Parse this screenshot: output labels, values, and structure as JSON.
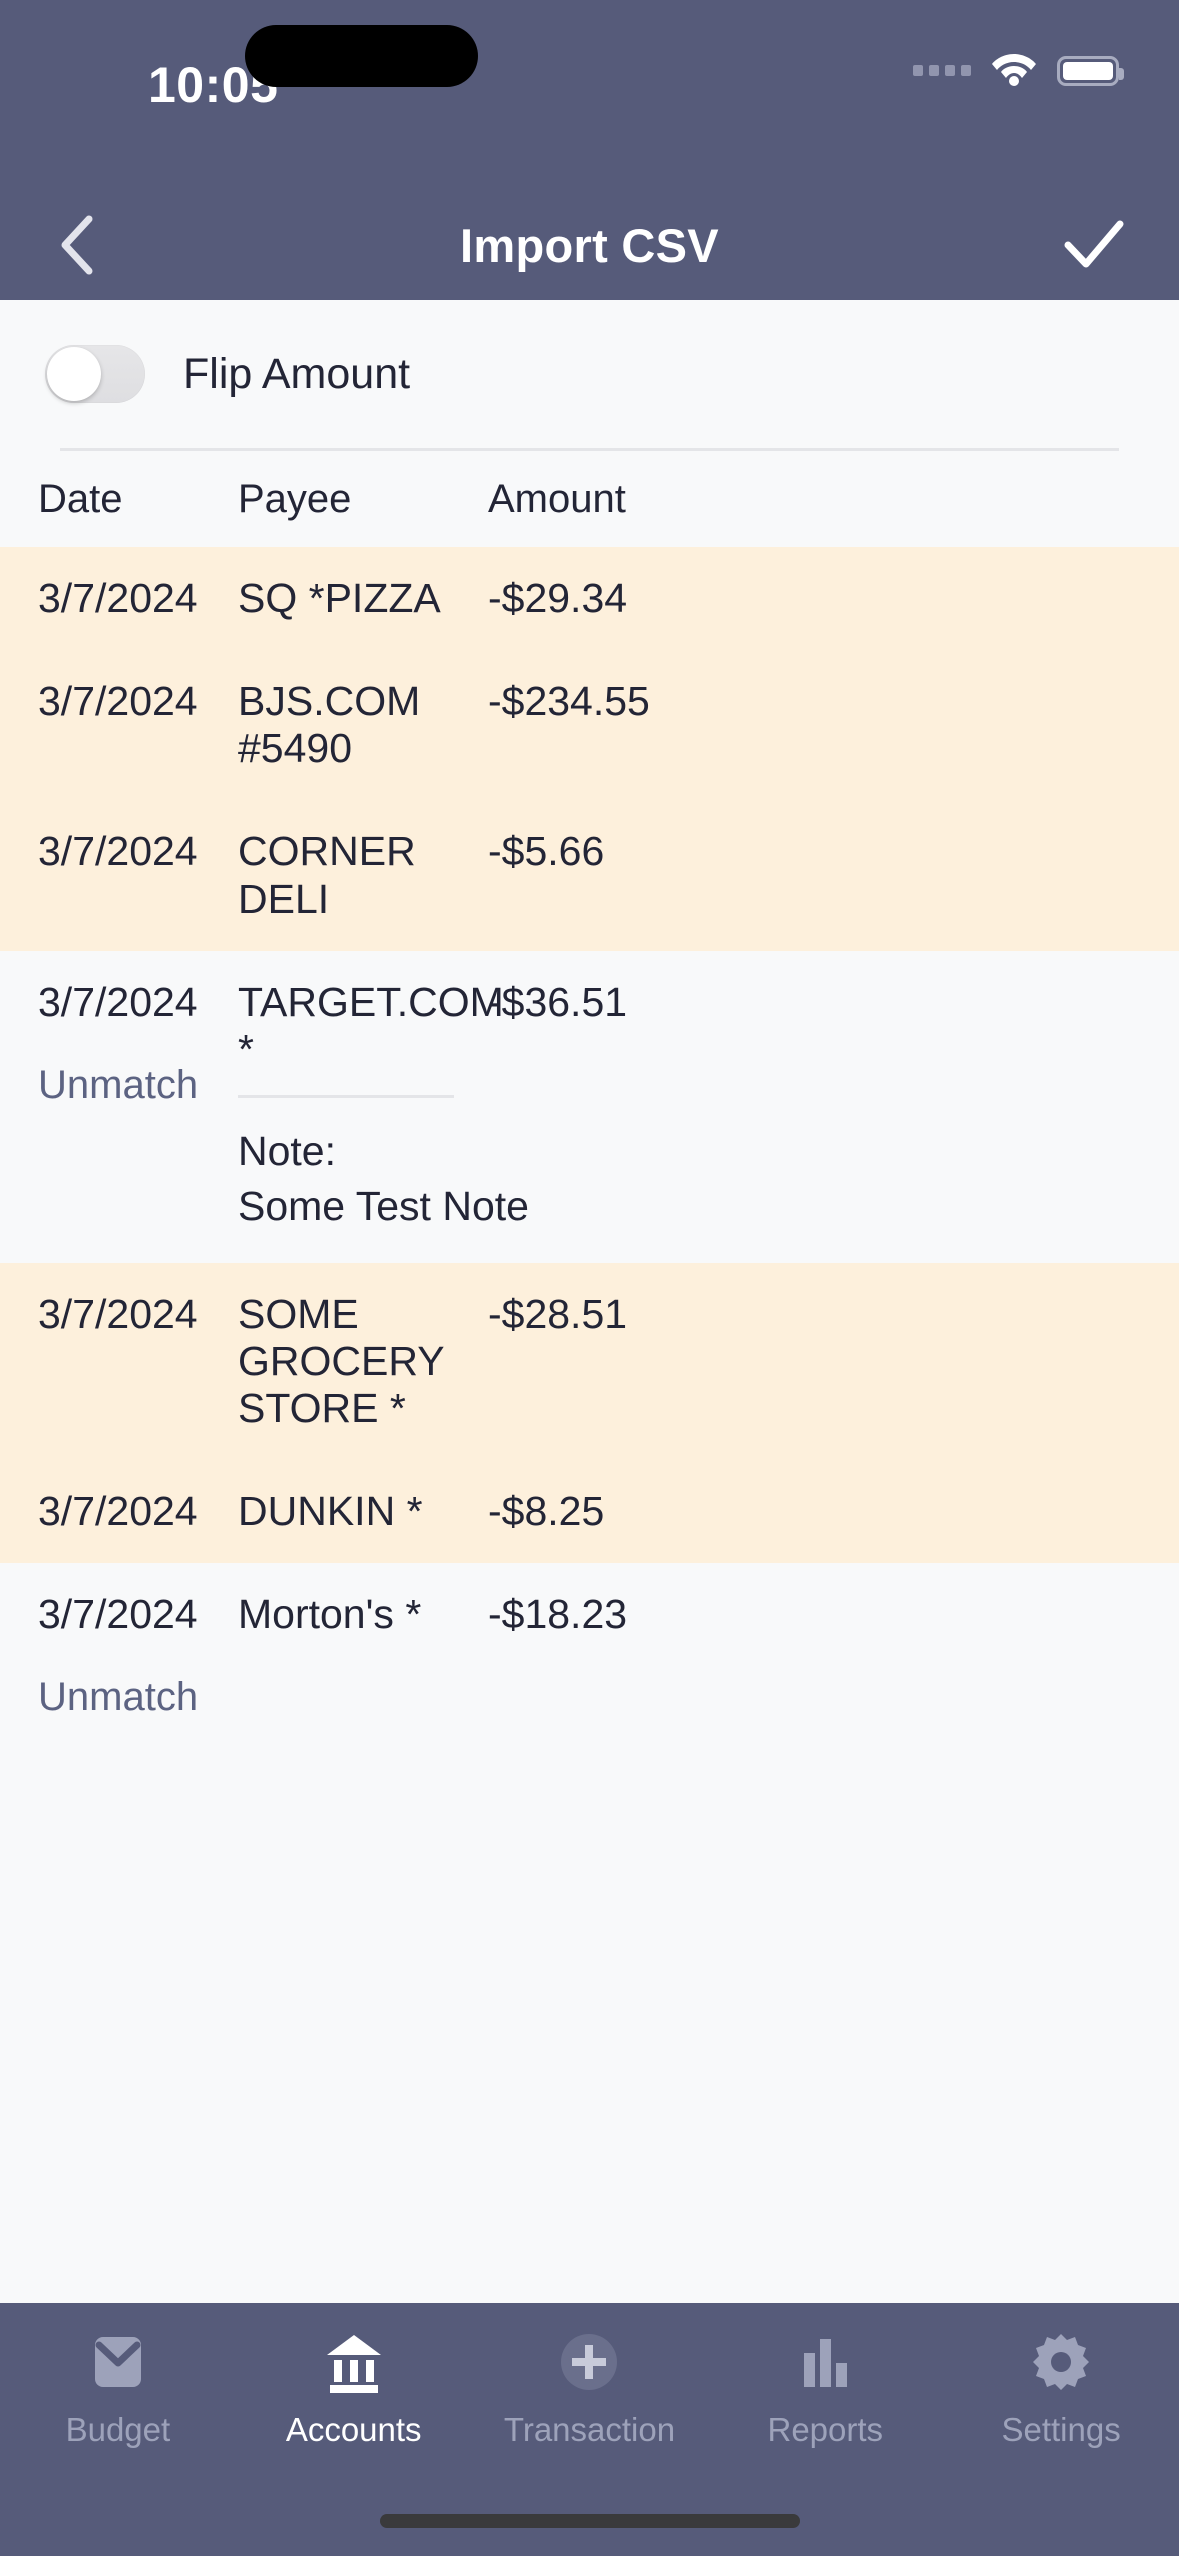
{
  "status_bar": {
    "time": "10:05",
    "signal_icon": "signal-dots-icon",
    "wifi_icon": "wifi-icon",
    "battery_icon": "battery-icon"
  },
  "nav_bar": {
    "back_icon": "chevron-left-icon",
    "title": "Import CSV",
    "done_icon": "checkmark-icon",
    "background_color": "#565B7A"
  },
  "flip_amount": {
    "label": "Flip Amount",
    "enabled": false
  },
  "table": {
    "headers": {
      "date": "Date",
      "payee": "Payee",
      "amount": "Amount"
    },
    "row_highlight_color": "#FDF0DC",
    "row_plain_color": "#F8F9FA",
    "rows": [
      {
        "date": "3/7/2024",
        "payee": "SQ *PIZZA",
        "amount": "-$29.34",
        "highlighted": true,
        "unmatch": null,
        "note_label": null,
        "note_text": null
      },
      {
        "date": "3/7/2024",
        "payee": "BJS.COM #5490",
        "amount": "-$234.55",
        "highlighted": true,
        "unmatch": null,
        "note_label": null,
        "note_text": null
      },
      {
        "date": "3/7/2024",
        "payee": "CORNER DELI",
        "amount": "-$5.66",
        "highlighted": true,
        "unmatch": null,
        "note_label": null,
        "note_text": null
      },
      {
        "date": "3/7/2024",
        "payee": "TARGET.COM  *",
        "amount": "-$36.51",
        "highlighted": false,
        "unmatch": "Unmatch",
        "note_label": "Note:",
        "note_text": "Some Test Note"
      },
      {
        "date": "3/7/2024",
        "payee": "SOME GROCERY STORE  *",
        "amount": "-$28.51",
        "highlighted": true,
        "unmatch": null,
        "note_label": null,
        "note_text": null
      },
      {
        "date": "3/7/2024",
        "payee": "DUNKIN  *",
        "amount": "-$8.25",
        "highlighted": true,
        "unmatch": null,
        "note_label": null,
        "note_text": null
      },
      {
        "date": "3/7/2024",
        "payee": "Morton's  *",
        "amount": "-$18.23",
        "highlighted": false,
        "unmatch": "Unmatch",
        "note_label": null,
        "note_text": null
      }
    ]
  },
  "tab_bar": {
    "active_index": 1,
    "active_color": "#FFFFFF",
    "inactive_color": "#9DA2BA",
    "items": [
      {
        "label": "Budget",
        "icon": "envelope-icon"
      },
      {
        "label": "Accounts",
        "icon": "bank-icon"
      },
      {
        "label": "Transaction",
        "icon": "plus-circle-icon"
      },
      {
        "label": "Reports",
        "icon": "bar-chart-icon"
      },
      {
        "label": "Settings",
        "icon": "gear-icon"
      }
    ]
  }
}
